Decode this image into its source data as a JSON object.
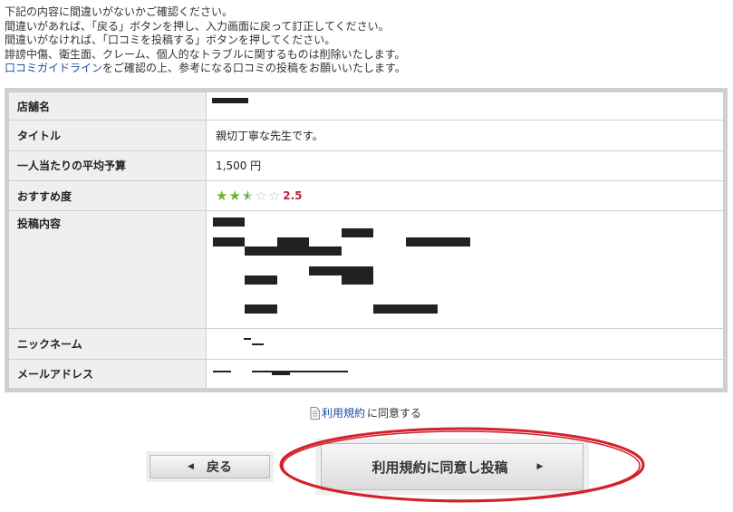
{
  "intro": {
    "line1": "下記の内容に間違いがないかご確認ください。",
    "line2": "間違いがあれば、「戻る」ボタンを押し、入力画面に戻って訂正してください。",
    "line3": "間違いがなければ、「口コミを投稿する」ボタンを押してください。",
    "line4": "誹謗中傷、衛生面、クレーム、個人的なトラブルに関するものは削除いたします。",
    "line5_link": "口コミガイドライン",
    "line5_rest": "をご確認の上、参考になる口コミの投稿をお願いいたします。"
  },
  "table": {
    "rows": [
      {
        "label": "店舗名",
        "value": ""
      },
      {
        "label": "タイトル",
        "value": "親切丁寧な先生です。"
      },
      {
        "label": "一人当たりの平均予算",
        "value": "1,500 円"
      },
      {
        "label": "おすすめ度",
        "value": ""
      },
      {
        "label": "投稿内容",
        "value": ""
      },
      {
        "label": "ニックネーム",
        "value": ""
      },
      {
        "label": "メールアドレス",
        "value": ""
      }
    ],
    "rating": {
      "value": "2.5",
      "stars": 2.5,
      "max": 5,
      "star_color": "#6ab82a",
      "number_color": "#c0203b"
    }
  },
  "agree": {
    "link": "利用規約",
    "text": "に同意する",
    "icon": "document-icon"
  },
  "buttons": {
    "back": "戻る",
    "submit": "利用規約に同意し投稿"
  },
  "colors": {
    "link": "#1a4fa0",
    "annotation_circle": "#d4202a"
  }
}
